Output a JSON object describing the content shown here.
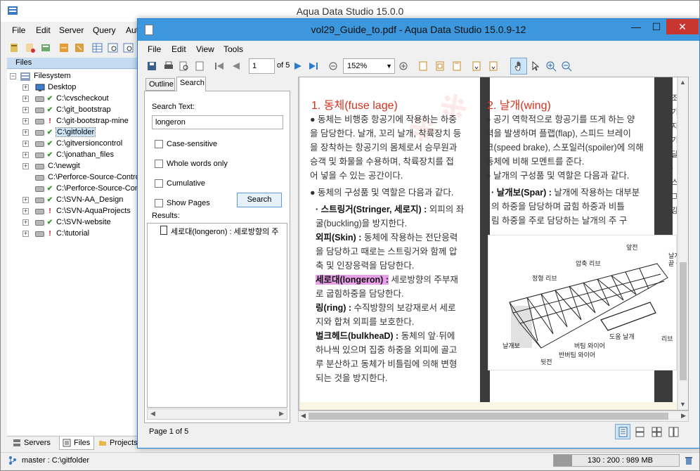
{
  "main_window": {
    "title": "Aqua Data Studio 15.0.0",
    "menu": [
      "File",
      "Edit",
      "Server",
      "Query",
      "Aut"
    ],
    "files_tab_label": "Files",
    "tree": {
      "root": "Filesystem",
      "items": [
        {
          "label": "Desktop",
          "kind": "desktop"
        },
        {
          "label": "C:\\cvscheckout",
          "status": "ok"
        },
        {
          "label": "C:\\git_bootstrap",
          "status": "ok"
        },
        {
          "label": "C:\\git-bootstrap-mine",
          "status": "alert"
        },
        {
          "label": "C:\\gitfolder",
          "status": "ok",
          "selected": true
        },
        {
          "label": "C:\\gitversioncontrol",
          "status": "ok"
        },
        {
          "label": "C:\\jonathan_files",
          "status": "ok"
        },
        {
          "label": "C:\\newgit",
          "status": "none"
        },
        {
          "label": "C:\\Perforce-Source-Contro",
          "status": "none"
        },
        {
          "label": "C:\\Perforce-Source-Con",
          "status": "ok"
        },
        {
          "label": "C:\\SVN-AA_Design",
          "status": "ok"
        },
        {
          "label": "C:\\SVN-AquaProjects",
          "status": "alert"
        },
        {
          "label": "C:\\SVN-website",
          "status": "ok"
        },
        {
          "label": "C:\\tutorial",
          "status": "alert"
        }
      ]
    },
    "bottom_tabs": [
      "Servers",
      "Files",
      "Projects"
    ],
    "status": {
      "git": "master : C:\\gitfolder",
      "memory": "130 : 200 : 989 MB"
    }
  },
  "pdf_window": {
    "title": "vol29_Guide_to.pdf - Aqua Data Studio 15.0.9-12",
    "menu": [
      "File",
      "Edit",
      "View",
      "Tools"
    ],
    "page_input": "1",
    "page_of": "of 5",
    "zoom": "152%",
    "side_tabs": [
      "Outline",
      "Search"
    ],
    "search": {
      "label": "Search Text:",
      "value": "longeron",
      "case_sensitive": "Case-sensitive",
      "whole_words": "Whole words only",
      "cumulative": "Cumulative",
      "show_pages": "Show Pages",
      "button": "Search",
      "results_label": "Results:",
      "result": "세로대(longeron) : 세로방향의 주"
    },
    "footer_page": "Page 1 of 5",
    "document": {
      "left_heading": "1. 동체(fuse lage)",
      "right_heading": "2. 날개(wing)",
      "left_col": [
        "● 동체는 비행중 항공기에 작용하는 하중",
        "을 담당한다. 날개, 꼬리 날개, 착륙장치 등",
        "을 장착하는 항공기의 몸체로서 승무원과",
        "승객 및 화물을 수용하며, 착륙장치를 접",
        "어 넣을 수 있는 공간이다."
      ],
      "left_bullet2": "● 동체의 구성품 및 역할은 다음과 같다.",
      "stringer_term": "· 스트링거(Stringer, 세로지) :",
      "stringer_desc": [
        " 외피의 좌",
        "굴(buckling)을 방지한다."
      ],
      "skin_term": "외피(Skin) :",
      "skin_desc": [
        " 동체에 작용하는 전단응력",
        "을 담당하고 때로는 스트링거와 함께 압",
        "축 및 인장응력을 담당한다."
      ],
      "longeron_term": "세로대(longeron) :",
      "longeron_desc": [
        " 세로방향의 주부재",
        "로 굽힘하중을 담당한다."
      ],
      "ring_term": "링(ring) :",
      "ring_desc": [
        " 수직방향의 보강재로서 세로",
        "지와 합쳐 외피를 보호한다."
      ],
      "bulkhead_term": "벌크헤드(bulkheaD) :",
      "bulkhead_desc": [
        " 동체의 앞·뒤에",
        "하나씩 있으며 집중 하중을 외피에 골고",
        "루 분산하고 동체가 비틀림에 의해 변형",
        "되는 것을 방지한다."
      ],
      "right_col": [
        "● 공기 역학적으로 항공기를 뜨게 하는 양",
        "력을 발생하며 플랩(flap), 스피드 브레이",
        "크(speed brake), 스포일러(spoiler)에 의해",
        "동체에 비해 모멘트를 준다."
      ],
      "right_bullet2": "● 날개의 구성품 및 역할은 다음과 같다.",
      "spar_term": "· 날개보(Spar) :",
      "spar_desc": [
        " 날개에 작용하는 대부분",
        "의 하중을 담당하며 굽힘 하중과 비틀",
        "림 하중을 주로 담당하는 날개의 주 구"
      ],
      "diagram_labels": [
        "앞전",
        "압축 리브",
        "정형 리브",
        "날개",
        "끝 블",
        "도움 날개",
        "리브",
        "버팀 와이어",
        "날개보",
        "반버팀 와이어",
        "뒷전"
      ],
      "far_right_fragments": [
        "조",
        "",
        "기",
        "지",
        "기",
        "달",
        "·스",
        "그",
        "",
        "강"
      ]
    }
  }
}
